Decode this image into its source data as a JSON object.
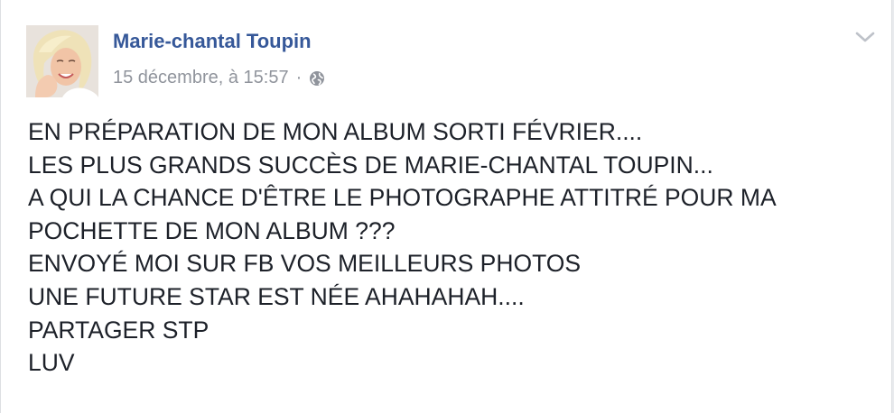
{
  "post": {
    "author": "Marie-chantal Toupin",
    "timestamp": "15 décembre, à 15:57",
    "separator": "·",
    "privacy_icon": "globe-icon",
    "menu_icon": "chevron-down-icon",
    "lines": [
      "EN PRÉPARATION DE MON ALBUM SORTI FÉVRIER....",
      "LES PLUS GRANDS SUCCÈS DE MARIE-CHANTAL TOUPIN...",
      "A QUI LA CHANCE D'ÊTRE LE PHOTOGRAPHE ATTITRÉ POUR MA",
      "POCHETTE DE MON ALBUM ???",
      "ENVOYÉ MOI SUR FB VOS MEILLEURS PHOTOS",
      "UNE FUTURE STAR EST NÉE AHAHAHAH....",
      "PARTAGER STP",
      "LUV"
    ]
  },
  "colors": {
    "author": "#365899",
    "meta": "#90949c",
    "text": "#1d2129",
    "background": "#ffffff"
  }
}
